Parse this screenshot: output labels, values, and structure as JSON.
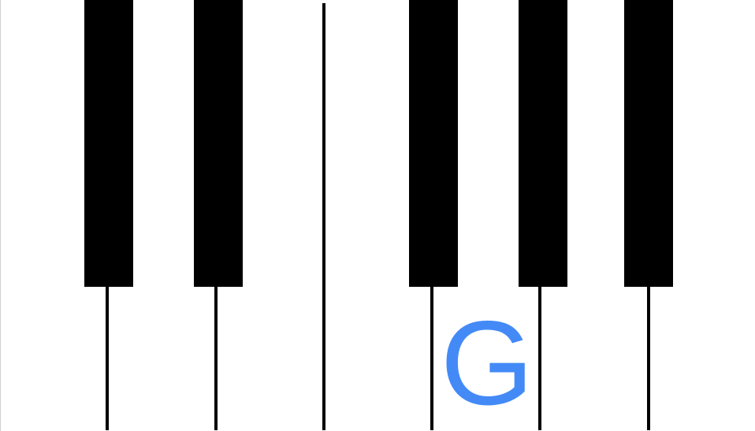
{
  "keyboard": {
    "highlighted_note": "G",
    "label_color": "#448af7",
    "white_key_color": "#ffffff",
    "black_key_color": "#000000"
  }
}
